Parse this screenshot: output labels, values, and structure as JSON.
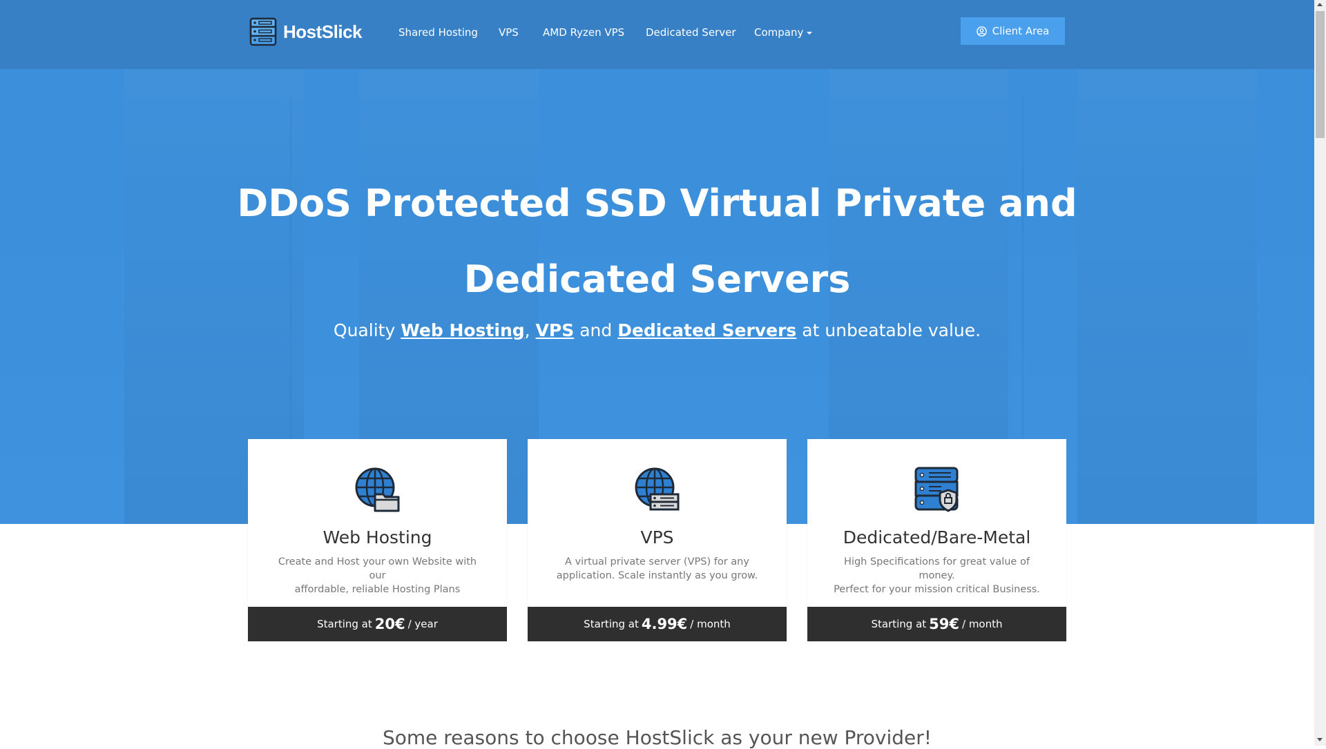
{
  "brand": {
    "name": "HostSlick",
    "icon": "server-rack-icon"
  },
  "nav": {
    "items": [
      {
        "label": "Shared Hosting"
      },
      {
        "label": "VPS"
      },
      {
        "label": "AMD Ryzen VPS"
      },
      {
        "label": "Dedicated Server"
      },
      {
        "label": "Company",
        "has_dropdown": true
      }
    ],
    "client_area": {
      "label": "Client Area",
      "icon": "user-circle-icon"
    }
  },
  "hero": {
    "title_line1": "DDoS Protected SSD Virtual Private and",
    "title_line2": "Dedicated Servers",
    "subtitle": {
      "prefix": "Quality",
      "link1": "Web Hosting",
      "comma": ",",
      "link2": "VPS",
      "and": "and",
      "link3": "Dedicated Servers",
      "suffix": "at unbeatable value."
    }
  },
  "cards": [
    {
      "icon": "globe-folder-icon",
      "title": "Web Hosting",
      "desc_line1": "Create and Host your own Website with our",
      "desc_line2": "affordable, reliable Hosting Plans",
      "price_prefix": "Starting at",
      "price": "20€",
      "price_suffix": "/ year"
    },
    {
      "icon": "globe-server-icon",
      "title": "VPS",
      "desc_line1": "A virtual private server (VPS) for any",
      "desc_line2": "application. Scale instantly as you grow.",
      "price_prefix": "Starting at",
      "price": "4.99€",
      "price_suffix": "/ month"
    },
    {
      "icon": "server-shield-icon",
      "title": "Dedicated/Bare-Metal",
      "desc_line1": "High Specifications for great value of money.",
      "desc_line2": "Perfect for your mission critical Business.",
      "price_prefix": "Starting at",
      "price": "59€",
      "price_suffix": "/ month"
    }
  ],
  "reasons": {
    "title": "Some reasons to choose HostSlick as your new Provider!"
  },
  "colors": {
    "hero_blue": "#3b8fdb",
    "navbar_blue": "#3780c6",
    "button_blue": "#4aa0ec",
    "footer_dark": "#2f2f2f",
    "icon_blue": "#2f80d0"
  }
}
